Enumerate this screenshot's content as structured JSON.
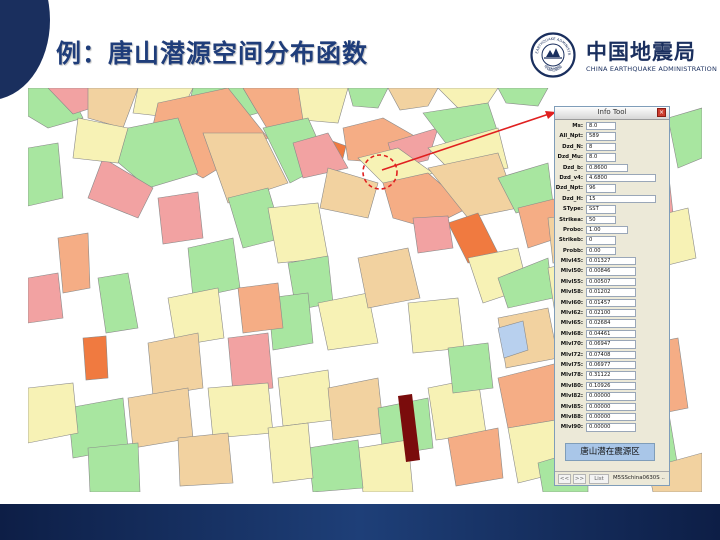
{
  "slide": {
    "title": "例：唐山潜源空间分布函数",
    "logo_cn": "中国地震局",
    "logo_en": "CHINA EARTHQUAKE ADMINISTRATION",
    "logo_seal_top": "CHINA EARTHQUAKE ADMINISTRATION",
    "logo_seal_bottom": "中国地震局"
  },
  "colors": {
    "title": "#1f3d7a",
    "navy": "#1a2f5e",
    "zone_green": "#a8e6a0",
    "zone_cream": "#f7f2b5",
    "zone_tan": "#f2d2a0",
    "zone_salmon": "#f5ad85",
    "zone_pink": "#f2a2a2",
    "zone_orange": "#f07a40",
    "zone_darkred": "#7a0c0c",
    "zone_blue": "#b8d0ee",
    "pointer": "#e02020"
  },
  "info_tool": {
    "title": "Info Tool",
    "close_icon": "×",
    "rows": [
      {
        "label": "Ms:",
        "value": "8.0"
      },
      {
        "label": "All_Npt:",
        "value": "589"
      },
      {
        "label": "Dzd_N:",
        "value": "8"
      },
      {
        "label": "Dzd_Mu:",
        "value": "8.0"
      },
      {
        "label": "Dzd_b:",
        "value": "0.8600"
      },
      {
        "label": "Dzd_v4:",
        "value": "4.6800"
      },
      {
        "label": "Dzd_Npt:",
        "value": "96"
      },
      {
        "label": "Dzd_H:",
        "value": "15"
      },
      {
        "label": "SType:",
        "value": "SST"
      },
      {
        "label": "Strikea:",
        "value": "50"
      },
      {
        "label": "Probo:",
        "value": "1.00"
      },
      {
        "label": "Strikeb:",
        "value": "0"
      },
      {
        "label": "Probb:",
        "value": "0.00"
      },
      {
        "label": "Mlvl45:",
        "value": "0.01327"
      },
      {
        "label": "Mlvl50:",
        "value": "0.00846"
      },
      {
        "label": "Mlvl55:",
        "value": "0.00507"
      },
      {
        "label": "Mlvl58:",
        "value": "0.01202"
      },
      {
        "label": "Mlvl60:",
        "value": "0.01457"
      },
      {
        "label": "Mlvl62:",
        "value": "0.02100"
      },
      {
        "label": "Mlvl65:",
        "value": "0.02684"
      },
      {
        "label": "Mlvl68:",
        "value": "0.04461"
      },
      {
        "label": "Mlvl70:",
        "value": "0.06947"
      },
      {
        "label": "Mlvl72:",
        "value": "0.07408"
      },
      {
        "label": "Mlvl75:",
        "value": "0.06977"
      },
      {
        "label": "Mlvl78:",
        "value": "0.31122"
      },
      {
        "label": "Mlvl80:",
        "value": "0.10926"
      },
      {
        "label": "Mlvl82:",
        "value": "0.00000"
      },
      {
        "label": "Mlvl85:",
        "value": "0.00000"
      },
      {
        "label": "Mlvl88:",
        "value": "0.00000"
      },
      {
        "label": "Mlvl90:",
        "value": "0.00000"
      }
    ],
    "note": "唐山潜在震源区",
    "nav_prev": "<<",
    "nav_next": ">>",
    "list_label": "List",
    "source": "M5SSchina0630S .."
  }
}
